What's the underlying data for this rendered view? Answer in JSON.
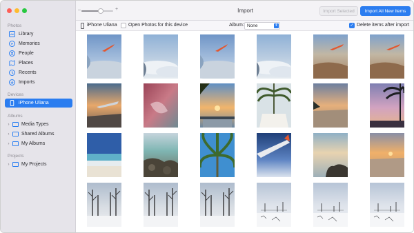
{
  "window": {
    "title": "Import"
  },
  "sidebar": {
    "sections": [
      {
        "title": "Photos",
        "items": [
          {
            "label": "Library",
            "icon": "library-icon"
          },
          {
            "label": "Memories",
            "icon": "memories-icon"
          },
          {
            "label": "People",
            "icon": "people-icon"
          },
          {
            "label": "Places",
            "icon": "places-icon"
          },
          {
            "label": "Recents",
            "icon": "recents-icon"
          },
          {
            "label": "Imports",
            "icon": "imports-icon"
          }
        ]
      },
      {
        "title": "Devices",
        "items": [
          {
            "label": "iPhone Uliana",
            "icon": "iphone-icon",
            "selected": true
          }
        ]
      },
      {
        "title": "Albums",
        "items": [
          {
            "label": "Media Types",
            "icon": "folder-icon"
          },
          {
            "label": "Shared Albums",
            "icon": "folder-icon"
          },
          {
            "label": "My Albums",
            "icon": "folder-icon"
          }
        ]
      },
      {
        "title": "Projects",
        "items": [
          {
            "label": "My Projects",
            "icon": "folder-icon"
          }
        ]
      }
    ]
  },
  "toolbar": {
    "import_selected_label": "Import Selected",
    "import_all_label": "Import All New Items",
    "zoom_minus": "–",
    "zoom_plus": "+",
    "zoom_level": 0.6
  },
  "devicebar": {
    "device_name": "iPhone Uliana",
    "open_photos_label": "Open Photos for this device",
    "open_photos_checked": false,
    "album_label": "Album:",
    "album_value": "None",
    "delete_label": "Delete items after import",
    "delete_checked": true
  },
  "photos": {
    "rows": [
      [
        "plane-wing-sky",
        "plane-wing-clouds",
        "plane-wing-sky",
        "plane-wing-clouds",
        "plane-wing-desert",
        "plane-wing-desert"
      ],
      [
        "plane-wing-sunset",
        "pink-water",
        "sunset-palms",
        "palm-shade",
        "beach-sunset",
        "palm-sunset-purple"
      ],
      [
        "beach-waves",
        "rocky-beach",
        "palm-from-below",
        "plane-wing-blue",
        "rocky-shore-sunset",
        "beach-sunset-orange"
      ],
      [
        "snow-trees",
        "snow-trees",
        "snow-trees",
        "snow-field",
        "snow-field",
        "snow-field"
      ]
    ]
  },
  "colors": {
    "accent": "#2b7df0",
    "sidebar_bg": "#e6e4ea",
    "traffic_red": "#fe5f57",
    "traffic_yellow": "#febc2e",
    "traffic_green": "#28c840"
  }
}
